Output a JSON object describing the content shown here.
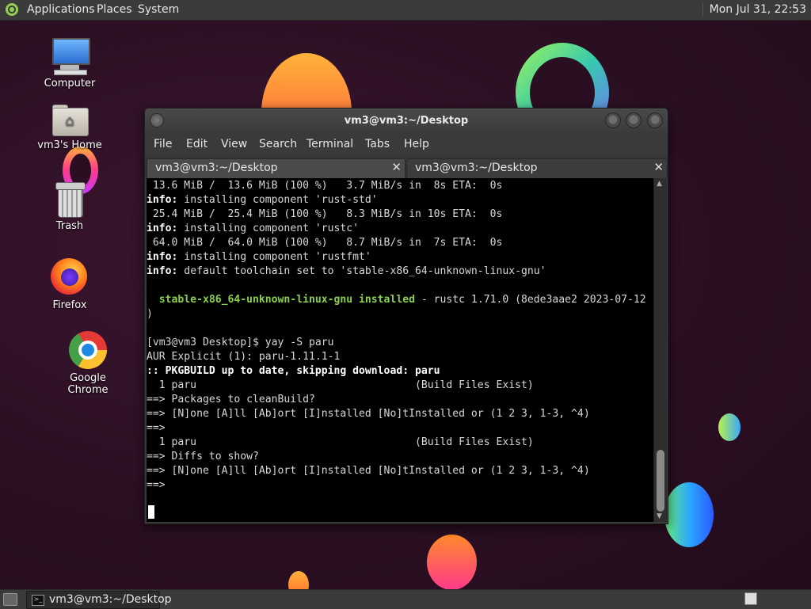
{
  "top_panel": {
    "menus": [
      "Applications",
      "Places",
      "System"
    ],
    "clock": "Mon Jul 31, 22:53"
  },
  "desktop_icons": {
    "computer": "Computer",
    "home": "vm3's Home",
    "trash": "Trash",
    "firefox": "Firefox",
    "chrome": "Google Chrome"
  },
  "terminal": {
    "window_title": "vm3@vm3:~/Desktop",
    "menu": [
      "File",
      "Edit",
      "View",
      "Search",
      "Terminal",
      "Tabs",
      "Help"
    ],
    "tabs": [
      "vm3@vm3:~/Desktop",
      "vm3@vm3:~/Desktop"
    ],
    "tab_close_glyph": "✕",
    "lines": [
      {
        "text": " 13.6 MiB /  13.6 MiB (100 %)   3.7 MiB/s in  8s ETA:  0s"
      },
      {
        "prefix": "info:",
        "text": " installing component 'rust-std'"
      },
      {
        "text": " 25.4 MiB /  25.4 MiB (100 %)   8.3 MiB/s in 10s ETA:  0s"
      },
      {
        "prefix": "info:",
        "text": " installing component 'rustc'"
      },
      {
        "text": " 64.0 MiB /  64.0 MiB (100 %)   8.7 MiB/s in  7s ETA:  0s"
      },
      {
        "prefix": "info:",
        "text": " installing component 'rustfmt'"
      },
      {
        "prefix": "info:",
        "text": " default toolchain set to 'stable-x86_64-unknown-linux-gnu'"
      },
      {
        "text": ""
      },
      {
        "green": "  stable-x86_64-unknown-linux-gnu installed",
        "text": " - rustc 1.71.0 (8ede3aae2 2023-07-12"
      },
      {
        "text": ")"
      },
      {
        "text": ""
      },
      {
        "text": "[vm3@vm3 Desktop]$ yay -S paru"
      },
      {
        "text": "AUR Explicit (1): paru-1.11.1-1"
      },
      {
        "boldline": ":: PKGBUILD up to date, skipping download: paru"
      },
      {
        "text": "  1 paru                                   (Build Files Exist)"
      },
      {
        "text": "==> Packages to cleanBuild?"
      },
      {
        "text": "==> [N]one [A]ll [Ab]ort [I]nstalled [No]tInstalled or (1 2 3, 1-3, ^4)"
      },
      {
        "text": "==>"
      },
      {
        "text": "  1 paru                                   (Build Files Exist)"
      },
      {
        "text": "==> Diffs to show?"
      },
      {
        "text": "==> [N]one [A]ll [Ab]ort [I]nstalled [No]tInstalled or (1 2 3, 1-3, ^4)"
      },
      {
        "text": "==>"
      }
    ]
  },
  "taskbar": {
    "task_label": "vm3@vm3:~/Desktop",
    "task_icon_glyph": ">_"
  },
  "icons": {
    "up_arrow": "▲",
    "down_arrow": "▼",
    "house": "⌂"
  }
}
